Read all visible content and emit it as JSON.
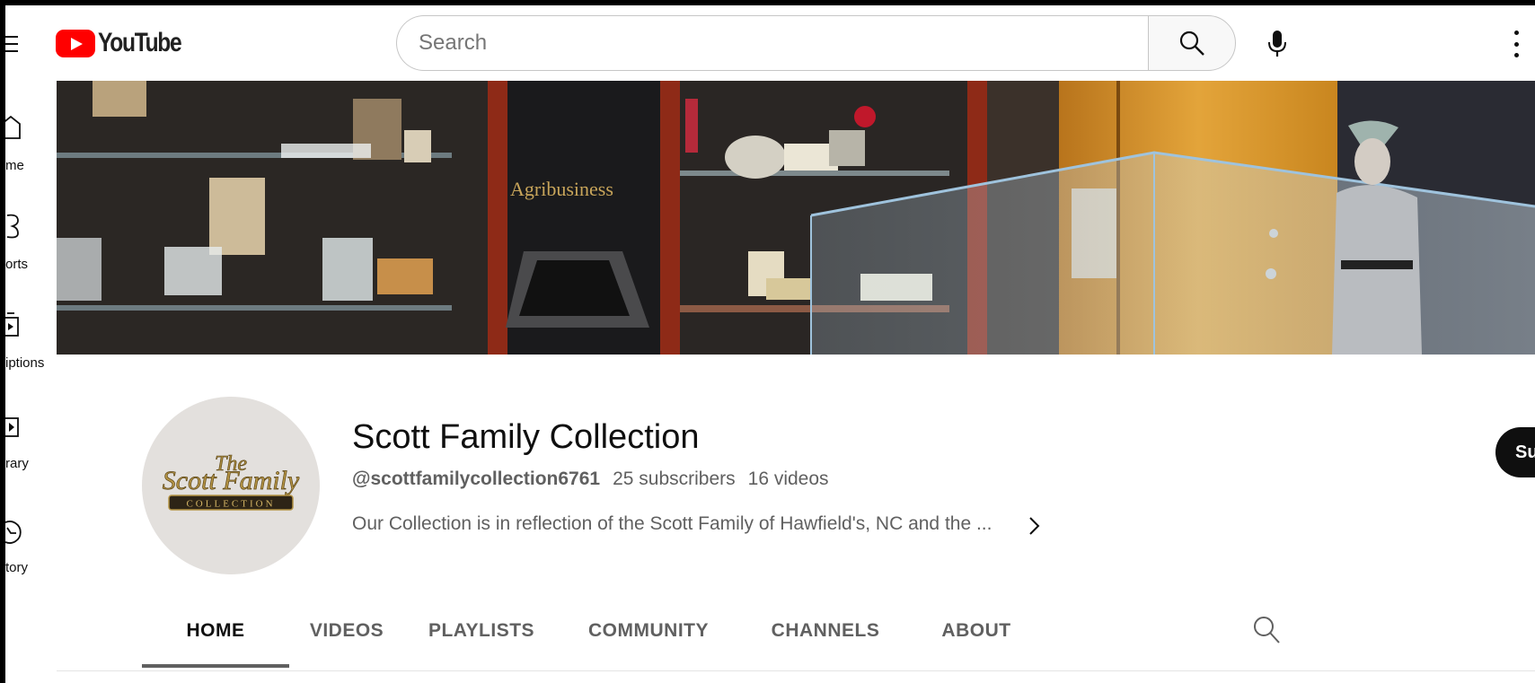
{
  "header": {
    "logo_text": "YouTube",
    "search_placeholder": "Search",
    "brand_color": "#ff0000"
  },
  "guide": {
    "items": [
      {
        "label": "me",
        "icon": "home-icon"
      },
      {
        "label": "orts",
        "icon": "shorts-icon"
      },
      {
        "label": "iptions",
        "icon": "subscriptions-icon"
      },
      {
        "label": "rary",
        "icon": "library-icon"
      },
      {
        "label": "tory",
        "icon": "history-icon"
      }
    ]
  },
  "banner": {
    "sign_text": "Agribusiness"
  },
  "channel": {
    "name": "Scott Family Collection",
    "handle": "@scottfamilycollection6761",
    "subscribers": "25 subscribers",
    "videos": "16 videos",
    "description": "Our Collection is in reflection of the Scott Family of Hawfield's, NC and the ...",
    "subscribe_label": "Su",
    "avatar_line1": "The",
    "avatar_line2": "Scott Family",
    "avatar_line3": "COLLECTION"
  },
  "tabs": [
    {
      "label": "HOME",
      "active": true
    },
    {
      "label": "VIDEOS",
      "active": false
    },
    {
      "label": "PLAYLISTS",
      "active": false
    },
    {
      "label": "COMMUNITY",
      "active": false
    },
    {
      "label": "CHANNELS",
      "active": false
    },
    {
      "label": "ABOUT",
      "active": false
    }
  ]
}
